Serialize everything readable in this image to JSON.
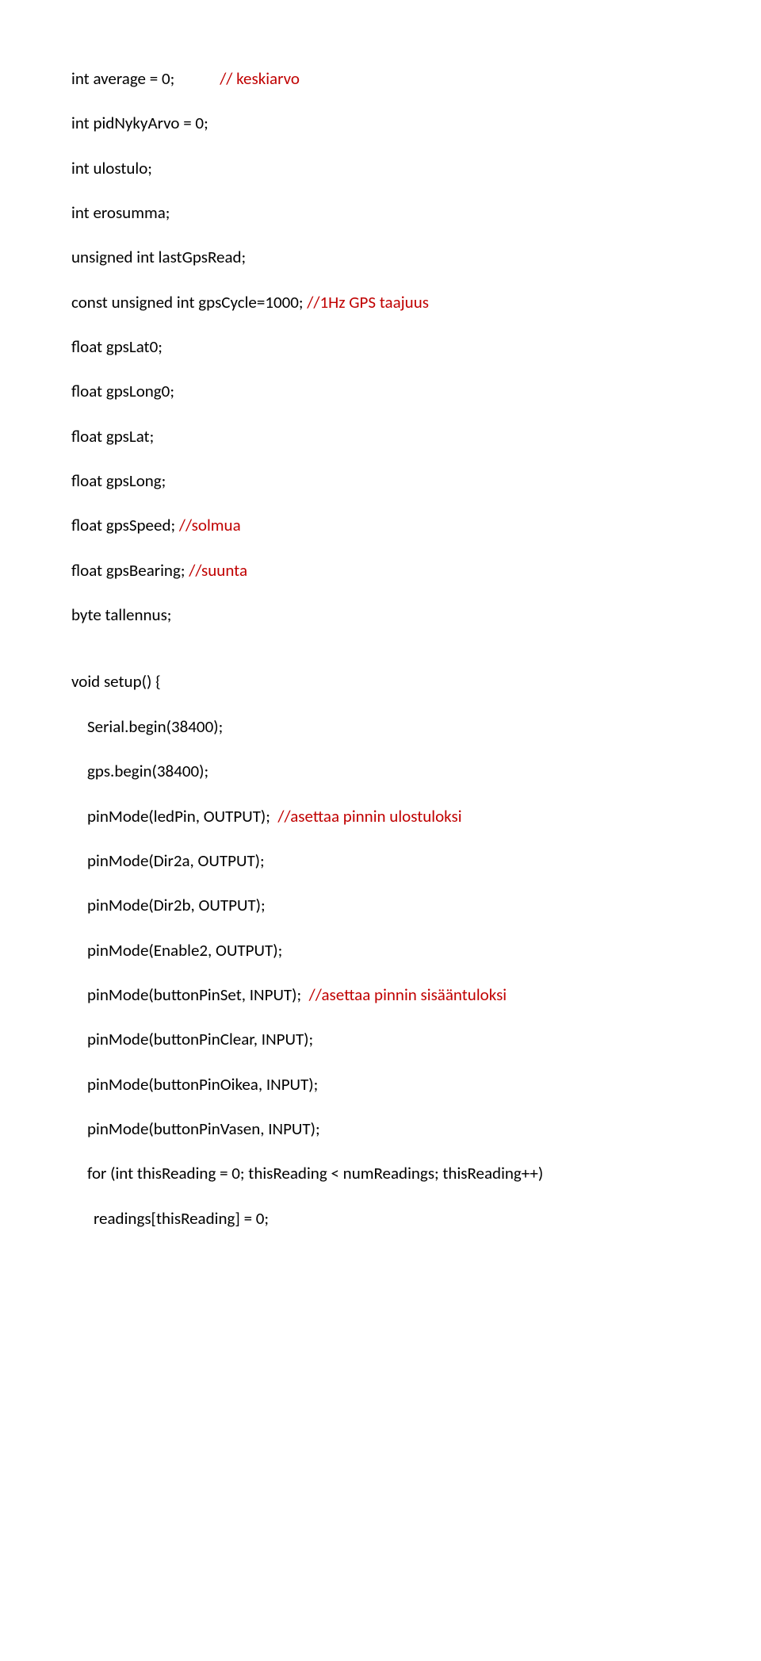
{
  "lines": [
    {
      "indent": 0,
      "segments": [
        {
          "text": "int average = 0;            ",
          "red": false
        },
        {
          "text": "// keskiarvo",
          "red": true
        }
      ]
    },
    {
      "indent": 0,
      "segments": [
        {
          "text": "int pidNykyArvo = 0;",
          "red": false
        }
      ]
    },
    {
      "indent": 0,
      "segments": [
        {
          "text": "int ulostulo;",
          "red": false
        }
      ]
    },
    {
      "indent": 0,
      "segments": [
        {
          "text": "int erosumma;",
          "red": false
        }
      ]
    },
    {
      "indent": 0,
      "segments": [
        {
          "text": "unsigned int lastGpsRead;",
          "red": false
        }
      ]
    },
    {
      "indent": 0,
      "segments": [
        {
          "text": "const unsigned int gpsCycle=1000; ",
          "red": false
        },
        {
          "text": "//1Hz GPS taajuus",
          "red": true
        }
      ]
    },
    {
      "indent": 0,
      "segments": [
        {
          "text": "float gpsLat0;",
          "red": false
        }
      ]
    },
    {
      "indent": 0,
      "segments": [
        {
          "text": "float gpsLong0;",
          "red": false
        }
      ]
    },
    {
      "indent": 0,
      "segments": [
        {
          "text": "float gpsLat;",
          "red": false
        }
      ]
    },
    {
      "indent": 0,
      "segments": [
        {
          "text": "float gpsLong;",
          "red": false
        }
      ]
    },
    {
      "indent": 0,
      "segments": [
        {
          "text": "float gpsSpeed; ",
          "red": false
        },
        {
          "text": "//solmua",
          "red": true
        }
      ]
    },
    {
      "indent": 0,
      "segments": [
        {
          "text": "float gpsBearing; ",
          "red": false
        },
        {
          "text": "//suunta",
          "red": true
        }
      ]
    },
    {
      "indent": 0,
      "segments": [
        {
          "text": "byte tallennus;",
          "red": false
        }
      ]
    },
    {
      "gap": true
    },
    {
      "indent": 0,
      "segments": [
        {
          "text": "void setup() {",
          "red": false
        }
      ]
    },
    {
      "indent": 1,
      "segments": [
        {
          "text": "Serial.begin(38400);",
          "red": false
        }
      ]
    },
    {
      "indent": 1,
      "segments": [
        {
          "text": "gps.begin(38400);",
          "red": false
        }
      ]
    },
    {
      "indent": 1,
      "segments": [
        {
          "text": "pinMode(ledPin, OUTPUT);  ",
          "red": false
        },
        {
          "text": "//asettaa pinnin ulostuloksi",
          "red": true
        }
      ]
    },
    {
      "indent": 1,
      "segments": [
        {
          "text": "pinMode(Dir2a, OUTPUT);",
          "red": false
        }
      ]
    },
    {
      "indent": 1,
      "segments": [
        {
          "text": "pinMode(Dir2b, OUTPUT);",
          "red": false
        }
      ]
    },
    {
      "indent": 1,
      "segments": [
        {
          "text": "pinMode(Enable2, OUTPUT);",
          "red": false
        }
      ]
    },
    {
      "indent": 1,
      "segments": [
        {
          "text": "pinMode(buttonPinSet, INPUT);  ",
          "red": false
        },
        {
          "text": "//asettaa pinnin sisääntuloksi",
          "red": true
        }
      ]
    },
    {
      "indent": 1,
      "segments": [
        {
          "text": "pinMode(buttonPinClear, INPUT);",
          "red": false
        }
      ]
    },
    {
      "indent": 1,
      "segments": [
        {
          "text": "pinMode(buttonPinOikea, INPUT);",
          "red": false
        }
      ]
    },
    {
      "indent": 1,
      "segments": [
        {
          "text": "pinMode(buttonPinVasen, INPUT);",
          "red": false
        }
      ]
    },
    {
      "indent": 1,
      "segments": [
        {
          "text": "for (int thisReading = 0; thisReading < numReadings; thisReading++)",
          "red": false
        }
      ]
    },
    {
      "indent": 2,
      "segments": [
        {
          "text": "readings[thisReading] = 0;",
          "red": false
        }
      ]
    }
  ]
}
